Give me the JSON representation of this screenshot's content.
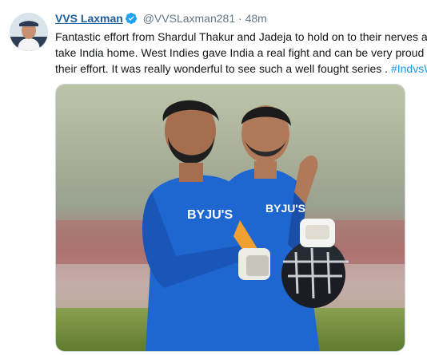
{
  "tweet": {
    "author": {
      "display_name": "VVS Laxman",
      "handle": "@VVSLaxman281",
      "verified": true
    },
    "separator": "·",
    "timestamp": "48m",
    "text_lines": [
      "Fantastic effort from Shardul Thakur and Jadeja to hold on to their nerves and",
      "take India home. West Indies gave India a real fight and can be very proud of",
      "their effort. It was really wonderful to see such a well fought series . "
    ],
    "hashtag": "#IndvsWI",
    "media": {
      "jersey_text_1": "BYJU'S",
      "jersey_text_2": "BYJU'S"
    }
  },
  "colors": {
    "link": "#1b5fa0",
    "hashtag": "#1b95e0",
    "verified": "#1da1f2",
    "jersey": "#1e66d0"
  }
}
